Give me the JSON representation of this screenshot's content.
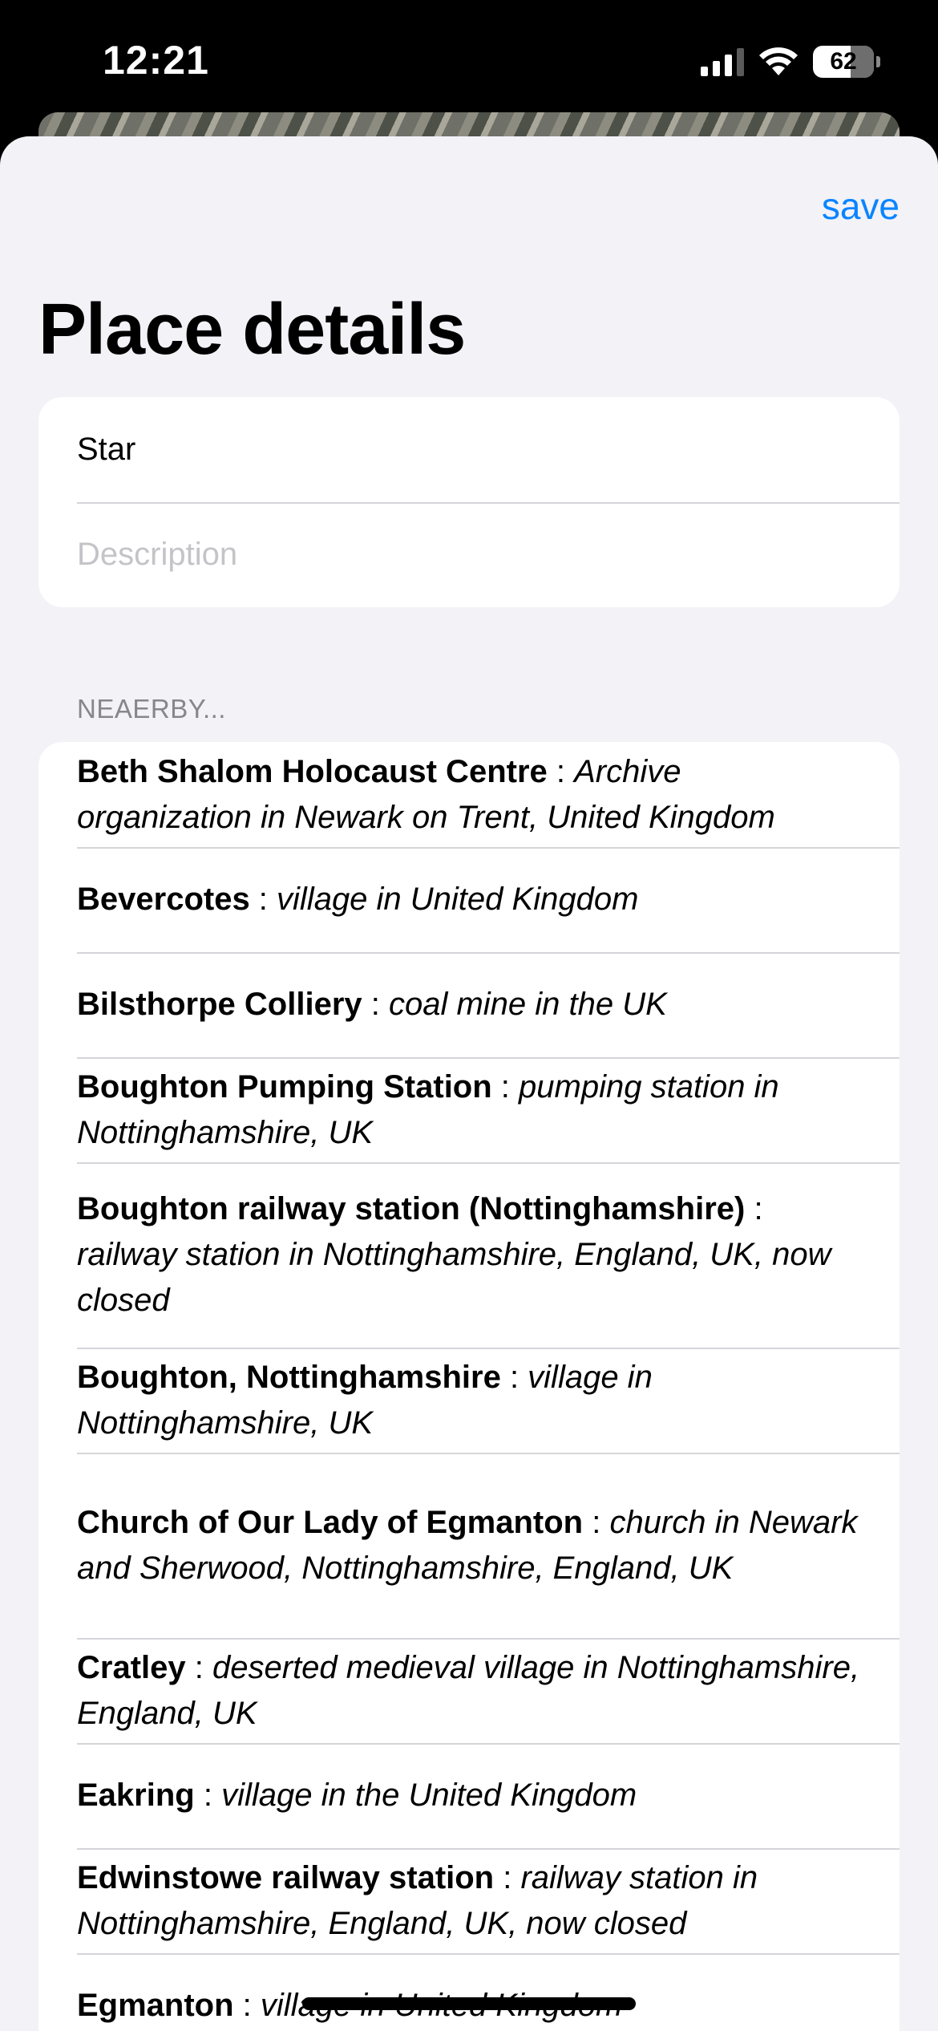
{
  "status_bar": {
    "time": "12:21",
    "battery": "62"
  },
  "header": {
    "save_label": "save",
    "title": "Place details"
  },
  "form": {
    "name_value": "Star",
    "description_placeholder": "Description"
  },
  "nearby": {
    "section_title": "NEAERBY...",
    "items": [
      {
        "name": "Beth Shalom Holocaust Centre",
        "description": "Archive organization in Newark on Trent, United Kingdom"
      },
      {
        "name": "Bevercotes",
        "description": "village in United Kingdom"
      },
      {
        "name": "Bilsthorpe Colliery",
        "description": "coal mine in the UK"
      },
      {
        "name": "Boughton Pumping Station",
        "description": "pumping station in Nottinghamshire, UK"
      },
      {
        "name": "Boughton railway station (Nottinghamshire)",
        "description": "railway station in Nottinghamshire, England, UK, now closed"
      },
      {
        "name": "Boughton, Nottinghamshire",
        "description": "village in Nottinghamshire, UK"
      },
      {
        "name": "Church of Our Lady of Egmanton",
        "description": "church in Newark and Sherwood, Nottinghamshire, England, UK"
      },
      {
        "name": "Cratley",
        "description": "deserted medieval village in Nottinghamshire, England, UK"
      },
      {
        "name": "Eakring",
        "description": "village in the United Kingdom"
      },
      {
        "name": "Edwinstowe railway station",
        "description": "railway station in Nottinghamshire, England, UK, now closed"
      },
      {
        "name": "Egmanton",
        "description": "village in United Kingdom"
      }
    ],
    "separator": " : "
  }
}
